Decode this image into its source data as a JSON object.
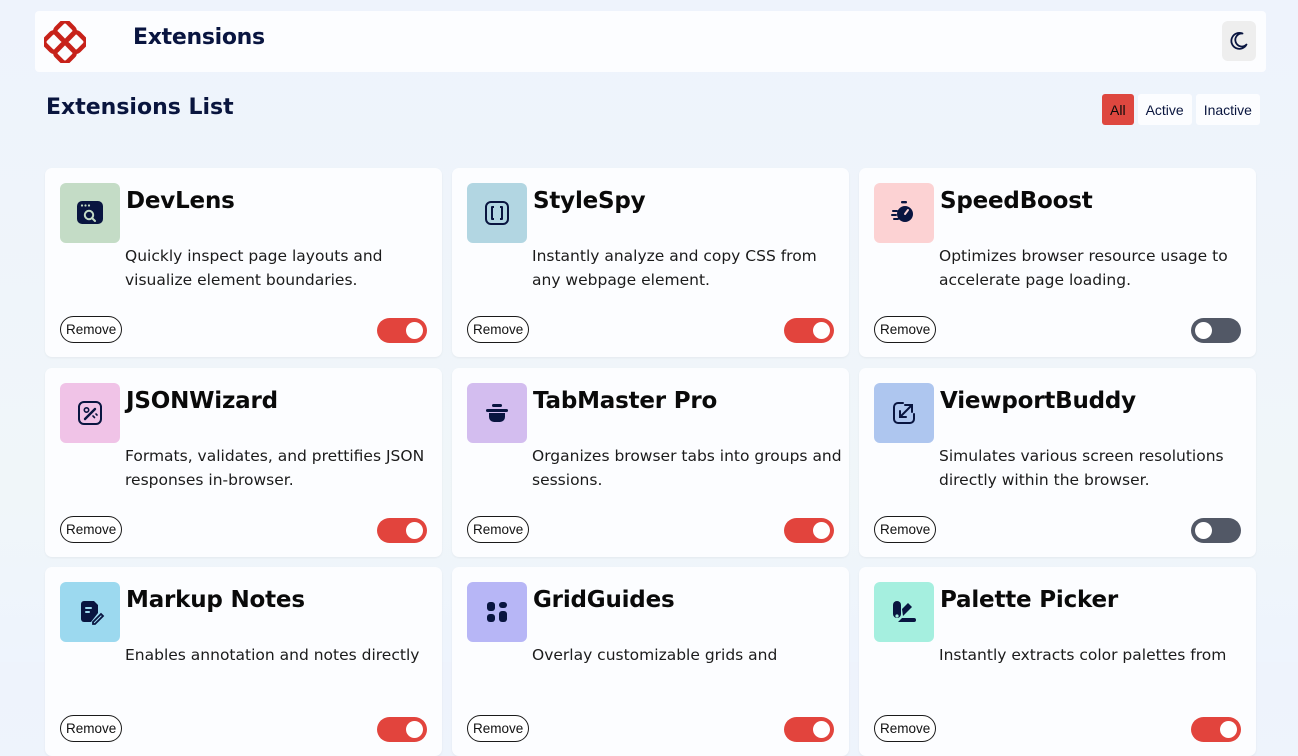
{
  "header": {
    "logo_text": "Extensions",
    "theme_toggle_icon": "moon-icon"
  },
  "list": {
    "title": "Extensions List",
    "filters": [
      {
        "label": "All",
        "selected": true
      },
      {
        "label": "Active",
        "selected": false
      },
      {
        "label": "Inactive",
        "selected": false
      }
    ]
  },
  "colors": {
    "accent": "#de473f",
    "toggle_off": "#525866",
    "heading": "#091540"
  },
  "extensions": [
    {
      "name": "DevLens",
      "description": "Quickly inspect page layouts and visualize element boundaries.",
      "remove_label": "Remove",
      "active": true,
      "icon": "browser-search-icon",
      "icon_bg": "#c4dcc6"
    },
    {
      "name": "StyleSpy",
      "description": "Instantly analyze and copy CSS from any webpage element.",
      "remove_label": "Remove",
      "active": true,
      "icon": "brackets-icon",
      "icon_bg": "#b2d6e2"
    },
    {
      "name": "SpeedBoost",
      "description": "Optimizes browser resource usage to accelerate page loading.",
      "remove_label": "Remove",
      "active": false,
      "icon": "stopwatch-icon",
      "icon_bg": "#fcd2d3"
    },
    {
      "name": "JSONWizard",
      "description": "Formats, validates, and prettifies JSON responses in-browser.",
      "remove_label": "Remove",
      "active": true,
      "icon": "wand-icon",
      "icon_bg": "#f0c3e7"
    },
    {
      "name": "TabMaster Pro",
      "description": "Organizes browser tabs into groups and sessions.",
      "remove_label": "Remove",
      "active": true,
      "icon": "pot-icon",
      "icon_bg": "#d3bdef"
    },
    {
      "name": "ViewportBuddy",
      "description": "Simulates various screen resolutions directly within the browser.",
      "remove_label": "Remove",
      "active": false,
      "icon": "resize-icon",
      "icon_bg": "#aec6ef"
    },
    {
      "name": "Markup Notes",
      "description": "Enables annotation and notes directly",
      "remove_label": "Remove",
      "active": true,
      "icon": "note-edit-icon",
      "icon_bg": "#9cd9ef"
    },
    {
      "name": "GridGuides",
      "description": "Overlay customizable grids and",
      "remove_label": "Remove",
      "active": true,
      "icon": "grid-icon",
      "icon_bg": "#b7b6f6"
    },
    {
      "name": "Palette Picker",
      "description": "Instantly extracts color palettes from",
      "remove_label": "Remove",
      "active": true,
      "icon": "palette-icon",
      "icon_bg": "#a5efdf"
    }
  ]
}
